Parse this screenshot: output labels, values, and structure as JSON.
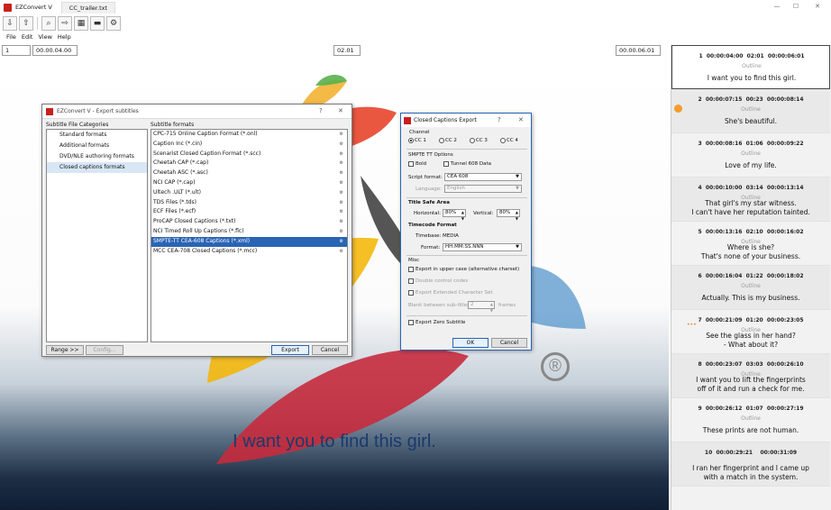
{
  "app": {
    "name": "EZConvert V",
    "file_tab": "CC_trailer.txt",
    "window_controls": [
      "—",
      "☐",
      "✕"
    ]
  },
  "toolbar": {
    "buttons": [
      {
        "icon": "import-icon",
        "glyph": "⇩"
      },
      {
        "icon": "export-icon",
        "glyph": "⇧"
      },
      {
        "icon": "search-icon",
        "glyph": "⌕"
      },
      {
        "icon": "forward-icon",
        "glyph": "⇨"
      },
      {
        "icon": "grid-icon",
        "glyph": "▦"
      },
      {
        "icon": "subtitle-icon",
        "glyph": "▬"
      },
      {
        "icon": "gear-icon",
        "glyph": "⚙"
      }
    ]
  },
  "menu": [
    "File",
    "Edit",
    "View",
    "Help"
  ],
  "timebar": {
    "index": "1",
    "start": "00.00.04.00",
    "duration": "02.01",
    "end": "00.00.06.01"
  },
  "video": {
    "subtitle": "I want you to find this girl.",
    "registered_mark": "®"
  },
  "subtitle_list": [
    {
      "num": "1",
      "start": "00:00:04:00",
      "dur": "02:01",
      "end": "00:00:06:01",
      "style": "Outline",
      "text": [
        "I want you to find this girl."
      ],
      "selected": true
    },
    {
      "num": "2",
      "start": "00:00:07:15",
      "dur": "00:23",
      "end": "00:00:08:14",
      "style": "Outline",
      "text": [
        "She's beautiful."
      ],
      "marker": true
    },
    {
      "num": "3",
      "start": "00:00:08:16",
      "dur": "01:06",
      "end": "00:00:09:22",
      "style": "Outline",
      "text": [
        "Love of my life."
      ]
    },
    {
      "num": "4",
      "start": "00:00:10:00",
      "dur": "03:14",
      "end": "00:00:13:14",
      "style": "Outline",
      "text": [
        "That girl's my star witness.",
        "I can't have her reputation tainted."
      ]
    },
    {
      "num": "5",
      "start": "00:00:13:16",
      "dur": "02:10",
      "end": "00:00:16:02",
      "style": "Outline",
      "text": [
        "Where is she?",
        "That's none of your business."
      ]
    },
    {
      "num": "6",
      "start": "00:00:16:04",
      "dur": "01:22",
      "end": "00:00:18:02",
      "style": "Outline",
      "text": [
        "Actually. This is my business."
      ]
    },
    {
      "num": "7",
      "start": "00:00:21:09",
      "dur": "01:20",
      "end": "00:00:23:05",
      "style": "Outline",
      "text": [
        "See the glass in her hand?",
        "- What about it?"
      ],
      "dots": "•••"
    },
    {
      "num": "8",
      "start": "00:00:23:07",
      "dur": "03:03",
      "end": "00:00:26:10",
      "style": "Outline",
      "text": [
        "I want you to lift the fingerprints",
        "off of it and run a check for me."
      ]
    },
    {
      "num": "9",
      "start": "00:00:26:12",
      "dur": "01:07",
      "end": "00:00:27:19",
      "style": "Outline",
      "text": [
        "These prints are not human."
      ]
    },
    {
      "num": "10",
      "start": "00:00:29:21",
      "dur": "",
      "end": "00:00:31:09",
      "style": "",
      "text": [
        "I ran her fingerprint and I came up",
        "with a match in the system."
      ]
    }
  ],
  "export_dialog": {
    "title": "EZConvert V - Export subtitles",
    "categories_label": "Subtitle File Categories",
    "formats_label": "Subtitle formats",
    "categories": [
      "Standard formats",
      "Additional formats",
      "DVD/NLE authoring formats",
      "Closed captions formats"
    ],
    "selected_category": 3,
    "formats": [
      "CPC-715 Online Caption Format  (*.onl)",
      "Caption Inc  (*.cin)",
      "Scenarist Closed Caption Format  (*.scc)",
      "Cheetah CAP  (*.cap)",
      "Cheetah ASC  (*.asc)",
      "NCI CAP  (*.cap)",
      "Ultech .ULT  (*.ult)",
      "TDS Files  (*.tds)",
      "ECF Files  (*.ecf)",
      "ProCAP Closed Captions  (*.txt)",
      "NCI Timed Roll Up Captions  (*.flc)",
      "SMPTE-TT CEA-608 Captions  (*.xml)",
      "MCC CEA-708 Closed Captions  (*.mcc)"
    ],
    "selected_format": 11,
    "range_button": "Range >>",
    "config_button": "Config...",
    "export_button": "Export",
    "cancel_button": "Cancel",
    "help": "?",
    "close": "✕"
  },
  "cc_dialog": {
    "title": "Closed Captions Export",
    "help": "?",
    "close": "✕",
    "channel_label": "Channel",
    "channels": [
      "CC 1",
      "CC 2",
      "CC 3",
      "CC 4"
    ],
    "selected_channel": 0,
    "smpte_label": "SMPTE TT Options",
    "bold_label": "Bold",
    "tunnel_label": "Tunnel 608 Data",
    "script_format_label": "Script format:",
    "script_format_value": "CEA 608",
    "language_label": "Language:",
    "language_value": "English",
    "title_safe_label": "Title Safe Area",
    "horizontal_label": "Horizontal:",
    "horizontal_value": "80%",
    "vertical_label": "Vertical:",
    "vertical_value": "80%",
    "timecode_label": "Timecode Format",
    "timebase_label": "Timebase:",
    "timebase_value": "MEDIA",
    "format_label": "Format:",
    "format_value": "HH:MM:SS.NNN",
    "misc_label": "Misc",
    "upper_case_label": "Export in upper case (alternative charset)",
    "double_codes_label": "Double control codes",
    "ext_chars_label": "Export Extended Character Set",
    "blank_label": "Blank between sub-titles",
    "blank_value": "2",
    "frames_label": "frames",
    "zero_label": "Export Zero Subtitle",
    "ok_button": "OK",
    "cancel_button": "Cancel"
  }
}
